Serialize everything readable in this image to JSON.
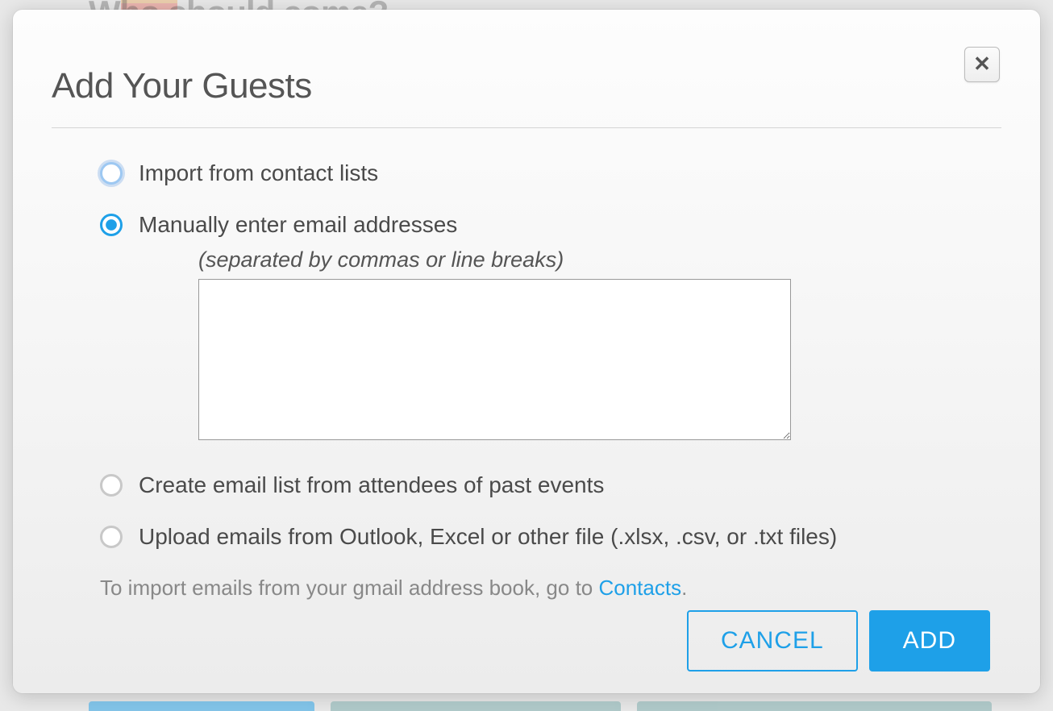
{
  "background": {
    "header_text": "Who should come?"
  },
  "modal": {
    "title": "Add Your Guests",
    "close_symbol": "✕",
    "options": {
      "import": "Import from contact lists",
      "manual": "Manually enter email addresses",
      "manual_hint": "(separated by commas or line breaks)",
      "past_events": "Create email list from attendees of past events",
      "upload": "Upload emails from Outlook, Excel or other file (.xlsx, .csv, or .txt files)"
    },
    "gmail_note_prefix": "To import emails from your gmail address book, go to ",
    "gmail_note_link": "Contacts",
    "gmail_note_suffix": ".",
    "buttons": {
      "cancel": "CANCEL",
      "add": "ADD"
    },
    "textarea_value": ""
  },
  "colors": {
    "accent": "#1ea0e8"
  }
}
